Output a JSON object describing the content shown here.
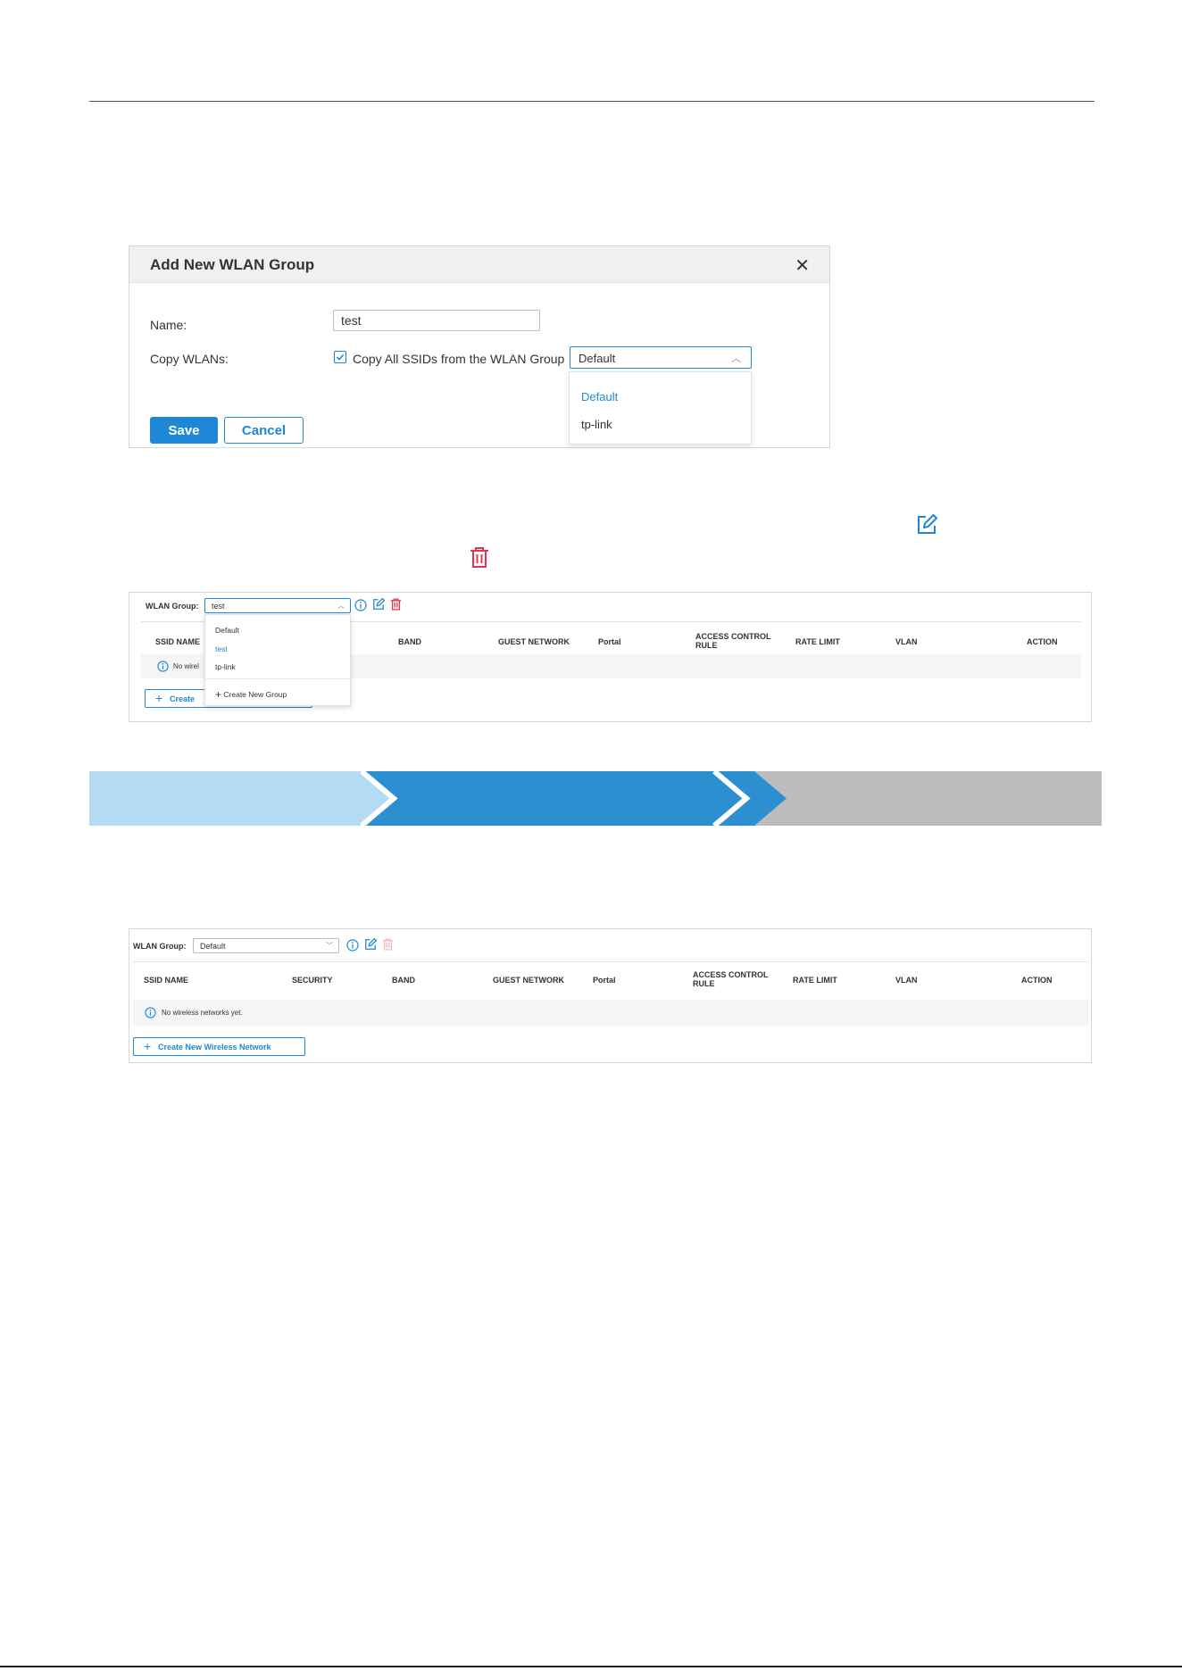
{
  "modal": {
    "title": "Add New WLAN Group",
    "name_label": "Name:",
    "name_value": "test",
    "copy_label": "Copy WLANs:",
    "copy_checked": true,
    "copy_text": "Copy All SSIDs from the WLAN Group",
    "copy_select_value": "Default",
    "copy_options": [
      "Default",
      "tp-link"
    ],
    "save_label": "Save",
    "cancel_label": "Cancel"
  },
  "panel_dropdown": {
    "group_label": "WLAN Group:",
    "group_value": "test",
    "menu_options": [
      "Default",
      "test",
      "tp-link"
    ],
    "menu_create": "Create New Group",
    "columns": [
      "SSID NAME",
      "BAND",
      "GUEST NETWORK",
      "Portal",
      "ACCESS CONTROL RULE",
      "RATE LIMIT",
      "VLAN",
      "ACTION"
    ],
    "empty_text": "No wirel",
    "create_label": "Create"
  },
  "steps": {
    "colors": [
      "#b3dcf4",
      "#2b8fd0",
      "#bdbdbd"
    ]
  },
  "panel_default": {
    "group_label": "WLAN Group:",
    "group_value": "Default",
    "columns": [
      "SSID NAME",
      "SECURITY",
      "BAND",
      "GUEST NETWORK",
      "Portal",
      "ACCESS CONTROL RULE",
      "RATE LIMIT",
      "VLAN",
      "ACTION"
    ],
    "empty_text": "No wireless networks yet.",
    "create_label": "Create New Wireless Network"
  },
  "colors": {
    "accent": "#1e88d6",
    "delete": "#e2364f"
  },
  "icons": [
    "close-icon",
    "check-icon",
    "chevron-up-icon",
    "chevron-down-icon",
    "info-icon",
    "edit-icon",
    "trash-icon",
    "plus-icon"
  ]
}
